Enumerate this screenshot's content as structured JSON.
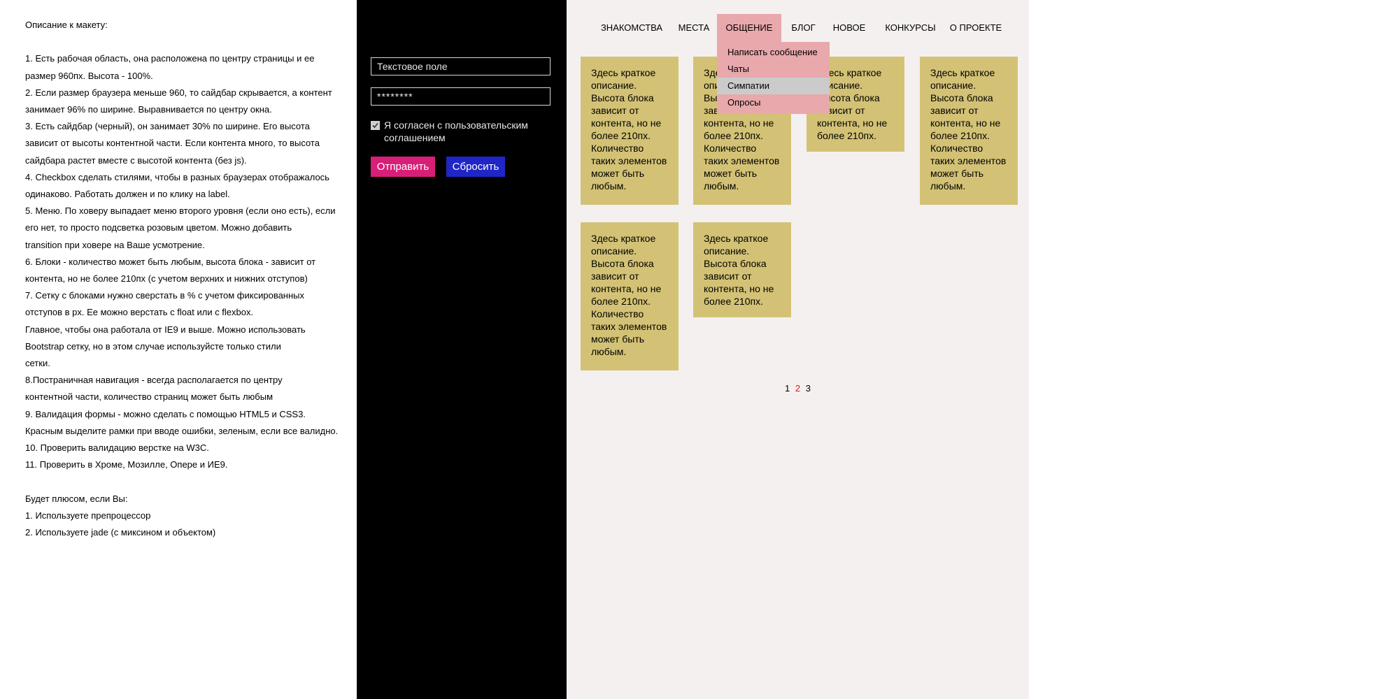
{
  "description": {
    "lines": [
      "Описание к макету:",
      "",
      "1. Есть рабочая область, она расположена по центру страницы и ее",
      "размер 960пх. Высота - 100%.",
      "2. Если размер браузера меньше 960, то сайдбар скрывается, а контент",
      "занимает 96% по ширине. Выравнивается по центру окна.",
      "3. Есть сайдбар (черный), он занимает 30% по ширине.  Его высота",
      "зависит от высоты контентной части. Если контента много, то высота",
      "сайдбара растет вместе с высотой контента (без js).",
      "4. Checkbox сделать стилями, чтобы в разных браузерах отображалось",
      "одинаково. Работать должен и по клику на label.",
      "5. Меню. По ховеру выпадает меню второго уровня (если оно есть), если",
      "его нет, то просто подсветка розовым цветом. Можно добавить",
      "transition при ховере на Ваше усмотрение.",
      "6. Блоки - количество может быть любым, высота блока - зависит от",
      "контента, но не более 210пх (с учетом верхних и нижних отступов)",
      "7. Сетку с блоками нужно сверстать в % с учетом фиксированных",
      "отступов в px. Ее можно верстать с float или с flexbox.",
      "Главное, чтобы она работала от IE9 и выше. Можно использовать",
      "Bootstrap сетку, но в этом случае используйсте только стили",
      "сетки.",
      "8.Постраничная навигация - всегда располагается по центру",
      "контентной части, количество страниц может быть любым",
      "9. Валидация формы - можно сделать с помощью HTML5 и CSS3.",
      "Красным выделите рамки при вводе ошибки, зеленым, если все валидно.",
      "10. Проверить валидацию верстке на  W3C.",
      "11. Проверить в Хроме, Мозилле, Опере и ИЕ9.",
      "",
      "Будет плюсом, если Вы:",
      "1. Используете препроцессор",
      "2. Используете jade (с миксином и объектом)"
    ]
  },
  "form": {
    "text_placeholder": "Текстовое поле",
    "password_value": "********",
    "agree_label": "Я согласен с пользовательским соглашением",
    "agree_checked": true,
    "submit_label": "Отправить",
    "reset_label": "Сбросить",
    "colors": {
      "submit": "#d81f78",
      "reset": "#1f25c6",
      "sidebar": "#000000"
    }
  },
  "menu": {
    "items": [
      {
        "label": "ЗНАКОМСТВА",
        "active": false
      },
      {
        "label": "МЕСТА",
        "active": false
      },
      {
        "label": "ОБЩЕНИЕ",
        "active": true
      },
      {
        "label": "БЛОГ",
        "active": false
      },
      {
        "label": "НОВОЕ",
        "active": false
      },
      {
        "label": "КОНКУРСЫ",
        "active": false
      },
      {
        "label": "О ПРОЕКТЕ",
        "active": false
      }
    ],
    "submenu": [
      {
        "label": "Написать сообщение",
        "hover": false
      },
      {
        "label": "Чаты",
        "hover": false
      },
      {
        "label": "Симпатии",
        "hover": true
      },
      {
        "label": "Опросы",
        "hover": false
      }
    ],
    "highlight_color": "#e8a8ac"
  },
  "cards": [
    {
      "text": "Здесь краткое описание. Высота блока зависит от контента, но не более 210пх. Количество таких элементов может быть любым."
    },
    {
      "text": "Здесь краткое описание. Высота блока зависит от контента, но не более 210пх. Количество таких элементов может быть любым."
    },
    {
      "text": "Здесь краткое описание. Высота блока зависит от контента, но не более 210пх."
    },
    {
      "text": "Здесь краткое описание. Высота блока зависит от контента, но не более 210пх. Количество таких элементов может быть любым."
    },
    {
      "text": "Здесь краткое описание. Высота блока зависит от контента, но не более 210пх. Количество таких элементов может быть любым."
    },
    {
      "text": "Здесь краткое описание. Высота блока зависит от контента, но не более 210пх."
    }
  ],
  "pagination": {
    "pages": [
      "1",
      "2",
      "3"
    ],
    "current": "2"
  },
  "colors": {
    "content_bg": "#f4f0ef",
    "card_bg": "#d3c275",
    "current_page": "#d0202a"
  }
}
